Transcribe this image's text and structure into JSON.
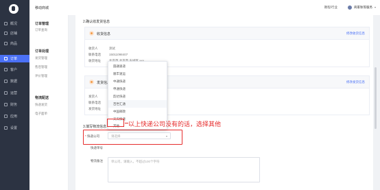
{
  "app": {
    "store_name": "移动商城"
  },
  "topbar": {
    "link": "教程/行业",
    "store": "商家秋等服务"
  },
  "nav_primary": [
    {
      "label": "概况"
    },
    {
      "label": "店铺"
    },
    {
      "label": "商品"
    },
    {
      "label": "订单",
      "active": true
    },
    {
      "label": "客户"
    },
    {
      "label": "数据"
    },
    {
      "label": "运营"
    },
    {
      "label": "财务"
    },
    {
      "label": "应用"
    },
    {
      "label": "设置"
    }
  ],
  "nav_secondary": {
    "groups": [
      {
        "title": "订单管理",
        "links": [
          "订单查询"
        ]
      },
      {
        "title": "订单处理",
        "links": [
          "发货管理",
          "售后管理",
          "评价管理"
        ]
      },
      {
        "title": "物流配送",
        "links": [
          "快递发货",
          "电子面单"
        ]
      }
    ]
  },
  "step2": {
    "title": "2.确认收发货信息",
    "receiver_card": {
      "title": "收货信息",
      "edit_link": "修改收货信息",
      "rows": [
        {
          "label": "收货人",
          "value": "测试"
        },
        {
          "label": "联系电话",
          "value": "15011098407"
        },
        {
          "label": "收货地址",
          "value": "北京市 北京市 东城区 xxx"
        }
      ]
    },
    "sender_card": {
      "title": "发货信息",
      "edit_link": "修改发货信息",
      "rows": [
        {
          "label": "发货人",
          "value": ""
        },
        {
          "label": "联系电话",
          "value": ""
        },
        {
          "label": "发货地址",
          "value": ""
        }
      ]
    }
  },
  "courier_dropdown": {
    "options": [
      "圆通速递",
      "顺丰速运",
      "中通快递",
      "申通快递",
      "韵达快递",
      "百世汇通",
      "中国邮政",
      "天天快递",
      "其他"
    ],
    "hover_index": 7,
    "highlighted": "其他"
  },
  "step3": {
    "title": "3.填写物流信息",
    "courier_label": "快递公司",
    "courier_placeholder": "请选择",
    "tracking_label": "快递单号",
    "remark_label": "物流备注",
    "remark_placeholder": "单公司，请输入，不超过100个字符"
  },
  "annotation": {
    "text": "以上快递公司没有的话，选择其他",
    "color": "#e62b2b"
  },
  "colors": {
    "accent": "#4b71f6",
    "nav_bg": "#2c3342",
    "annotation": "#e62b2b"
  }
}
